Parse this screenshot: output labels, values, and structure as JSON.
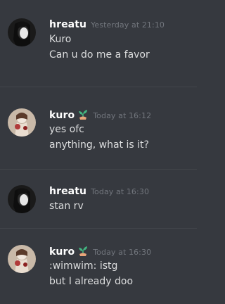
{
  "messages": [
    {
      "author": "hreatu",
      "timestamp": "Yesterday at 21:10",
      "lines": [
        "Kuro",
        "Can u do me a favor"
      ]
    },
    {
      "author": "kuro",
      "badge_icon": "plant-sprout-icon",
      "timestamp": "Today at 16:12",
      "lines": [
        "yes ofc",
        "anything, what is it?"
      ]
    },
    {
      "author": "hreatu",
      "timestamp": "Today at 16:30",
      "lines": [
        "stan rv"
      ]
    },
    {
      "author": "kuro",
      "badge_icon": "plant-sprout-icon",
      "timestamp": "Today at 16:30",
      "lines": [
        ":wimwim: istg",
        "but I already doo"
      ]
    }
  ],
  "colors": {
    "background": "#36393f",
    "username": "#ffffff",
    "timestamp": "#72767d",
    "text": "#dcddde",
    "badge": "#43b581"
  }
}
